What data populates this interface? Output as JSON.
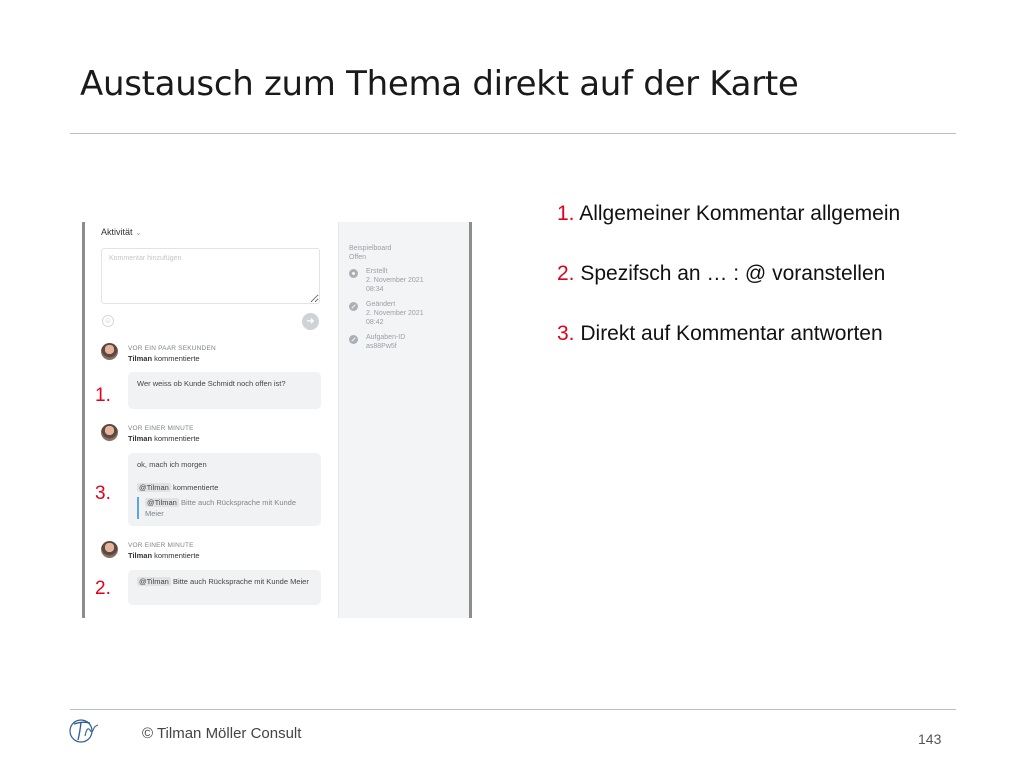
{
  "slide": {
    "title": "Austausch zum Thema direkt auf der Karte",
    "page_number": "143",
    "footer": "© Tilman Möller Consult"
  },
  "screenshot": {
    "activity_label": "Aktivität",
    "comment_placeholder": "Kommentar hinzufügen",
    "sidebar": {
      "board": "Beispielboard",
      "status": "Offen",
      "entries": [
        {
          "icon": "gear-icon",
          "label": "Erstellt",
          "date": "2. November 2021",
          "time": "08:34"
        },
        {
          "icon": "pencil-icon",
          "label": "Geändert",
          "date": "2. November 2021",
          "time": "08:42"
        },
        {
          "icon": "pencil-icon",
          "label": "Aufgaben-ID",
          "date": "as88Pw5f",
          "time": ""
        }
      ]
    },
    "comments": [
      {
        "time": "VOR EIN PAAR SEKUNDEN",
        "user": "Tilman",
        "action": "kommentierte",
        "text": "Wer weiss ob Kunde Schmidt noch offen ist?",
        "marker": "1."
      },
      {
        "time": "VOR EINER MINUTE",
        "user": "Tilman",
        "action": "kommentierte",
        "text": "ok, mach ich morgen",
        "reply_mention": "@Tilman",
        "reply_action": "kommentierte",
        "quote_mention": "@Tilman",
        "quote_text": "Bitte auch Rücksprache mit Kunde Meier",
        "marker": "3."
      },
      {
        "time": "VOR EINER MINUTE",
        "user": "Tilman",
        "action": "kommentierte",
        "mention": "@Tilman",
        "text": "Bitte auch Rücksprache mit Kunde Meier",
        "marker": "2."
      }
    ]
  },
  "points": [
    {
      "num": "1.",
      "text": "Allgemeiner Kommentar allgemein"
    },
    {
      "num": "2.",
      "text": "Spezifsch an … : @ voranstellen"
    },
    {
      "num": "3.",
      "text": "Direkt auf Kommentar antworten"
    }
  ],
  "colors": {
    "accent_red": "#e2001a",
    "quote_blue": "#5aa7e8"
  }
}
